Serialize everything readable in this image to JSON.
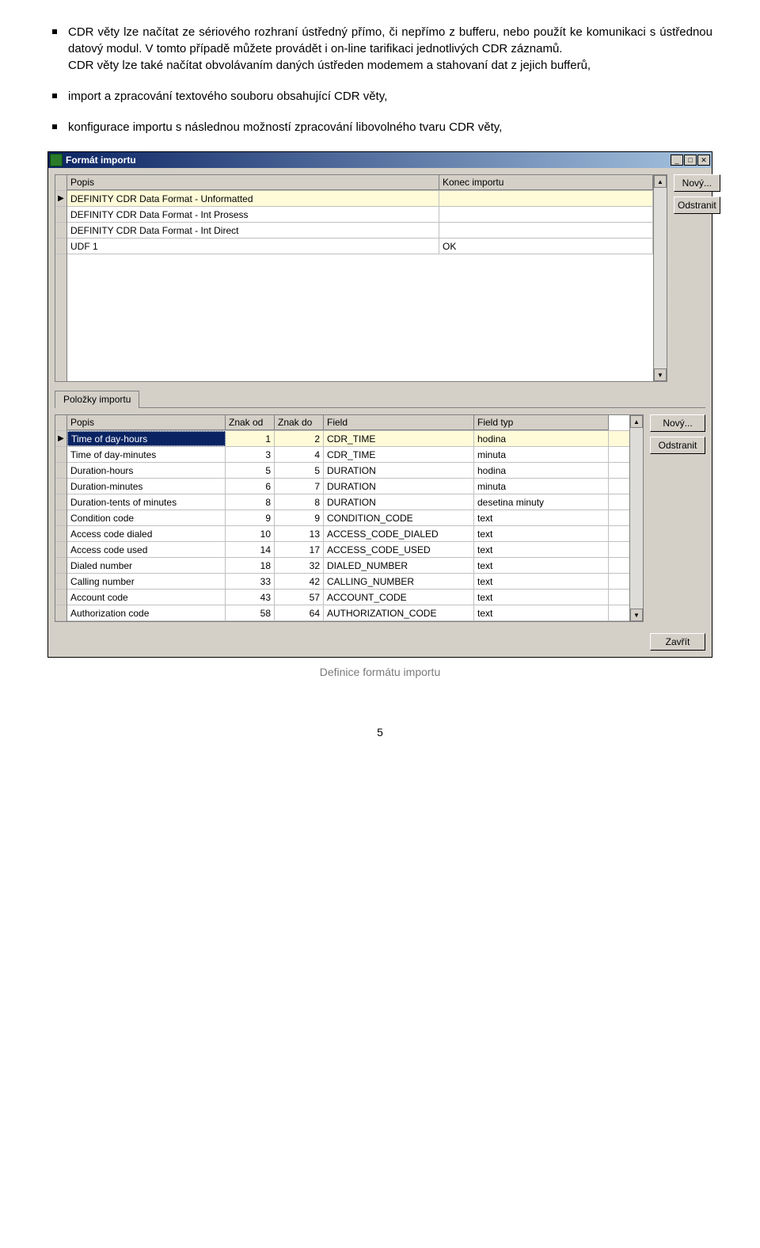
{
  "doc": {
    "bullet1": "CDR věty lze načítat ze sériového rozhraní ústředný přímo, či nepřímo z bufferu, nebo použít ke komunikaci s ústřednou datový modul. V tomto případě můžete provádět i on-line tarifikaci jednotlivých CDR záznamů.",
    "bullet1b": "CDR věty lze také načítat obvolávaním daných ústředen modemem a stahovaní dat z jejich bufferů,",
    "bullet2": "import a zpracování textového souboru obsahující CDR věty,",
    "bullet3": "konfigurace importu s následnou možností zpracování libovolného tvaru CDR věty,",
    "caption": "Definice formátu importu",
    "pagenum": "5"
  },
  "window": {
    "title": "Formát importu",
    "btn_new": "Nový...",
    "btn_remove": "Odstranit",
    "btn_close": "Zavřít",
    "tab_label": "Položky importu"
  },
  "grid_top": {
    "headers": {
      "popis": "Popis",
      "konec": "Konec importu"
    },
    "rows": [
      {
        "popis": "DEFINITY CDR Data Format - Unformatted",
        "konec": ""
      },
      {
        "popis": "DEFINITY CDR Data Format - Int Prosess",
        "konec": ""
      },
      {
        "popis": "DEFINITY CDR Data Format - Int Direct",
        "konec": ""
      },
      {
        "popis": "UDF 1",
        "konec": "OK"
      }
    ]
  },
  "grid_bottom": {
    "headers": {
      "popis": "Popis",
      "od": "Znak od",
      "do": "Znak do",
      "field": "Field",
      "typ": "Field typ"
    },
    "rows": [
      {
        "popis": "Time of day-hours",
        "od": "1",
        "do": "2",
        "field": "CDR_TIME",
        "typ": "hodina"
      },
      {
        "popis": "Time of day-minutes",
        "od": "3",
        "do": "4",
        "field": "CDR_TIME",
        "typ": "minuta"
      },
      {
        "popis": "Duration-hours",
        "od": "5",
        "do": "5",
        "field": "DURATION",
        "typ": "hodina"
      },
      {
        "popis": "Duration-minutes",
        "od": "6",
        "do": "7",
        "field": "DURATION",
        "typ": "minuta"
      },
      {
        "popis": "Duration-tents of minutes",
        "od": "8",
        "do": "8",
        "field": "DURATION",
        "typ": "desetina minuty"
      },
      {
        "popis": "Condition code",
        "od": "9",
        "do": "9",
        "field": "CONDITION_CODE",
        "typ": "text"
      },
      {
        "popis": "Access code dialed",
        "od": "10",
        "do": "13",
        "field": "ACCESS_CODE_DIALED",
        "typ": "text"
      },
      {
        "popis": "Access code used",
        "od": "14",
        "do": "17",
        "field": "ACCESS_CODE_USED",
        "typ": "text"
      },
      {
        "popis": "Dialed number",
        "od": "18",
        "do": "32",
        "field": "DIALED_NUMBER",
        "typ": "text"
      },
      {
        "popis": "Calling number",
        "od": "33",
        "do": "42",
        "field": "CALLING_NUMBER",
        "typ": "text"
      },
      {
        "popis": "Account code",
        "od": "43",
        "do": "57",
        "field": "ACCOUNT_CODE",
        "typ": "text"
      },
      {
        "popis": "Authorization code",
        "od": "58",
        "do": "64",
        "field": "AUTHORIZATION_CODE",
        "typ": "text"
      }
    ]
  }
}
